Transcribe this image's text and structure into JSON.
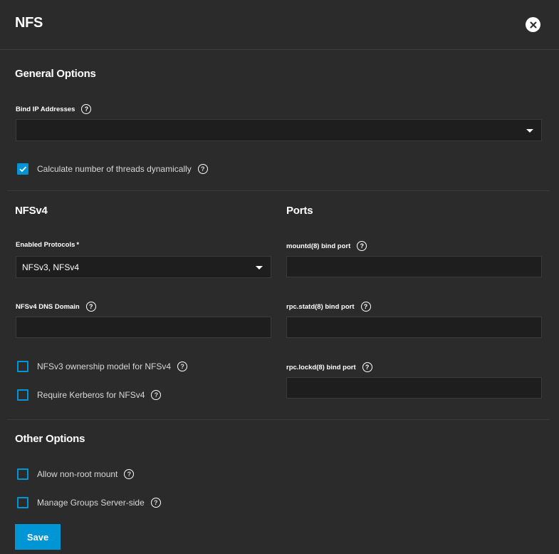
{
  "header": {
    "title": "NFS"
  },
  "general": {
    "title": "General Options",
    "bind_ip_label": "Bind IP Addresses",
    "bind_ip_value": "",
    "threads_label": "Calculate number of threads dynamically",
    "threads_checked": true
  },
  "nfsv4": {
    "title": "NFSv4",
    "protocols_label": "Enabled Protocols",
    "protocols_required": "*",
    "protocols_value": "NFSv3, NFSv4",
    "dns_label": "NFSv4 DNS Domain",
    "dns_value": "",
    "ownership_label": "NFSv3 ownership model for NFSv4",
    "ownership_checked": false,
    "kerberos_label": "Require Kerberos for NFSv4",
    "kerberos_checked": false
  },
  "ports": {
    "title": "Ports",
    "mountd_label": "mountd(8) bind port",
    "mountd_value": "",
    "statd_label": "rpc.statd(8) bind port",
    "statd_value": "",
    "lockd_label": "rpc.lockd(8) bind port",
    "lockd_value": ""
  },
  "other": {
    "title": "Other Options",
    "nonroot_label": "Allow non-root mount",
    "nonroot_checked": false,
    "groups_label": "Manage Groups Server-side",
    "groups_checked": false
  },
  "actions": {
    "save_label": "Save"
  },
  "icons": {
    "help": "?",
    "close": "✕",
    "check": "✓"
  },
  "colors": {
    "accent": "#0095d5",
    "background": "#2b2b2b",
    "field": "#1e1e1e"
  }
}
